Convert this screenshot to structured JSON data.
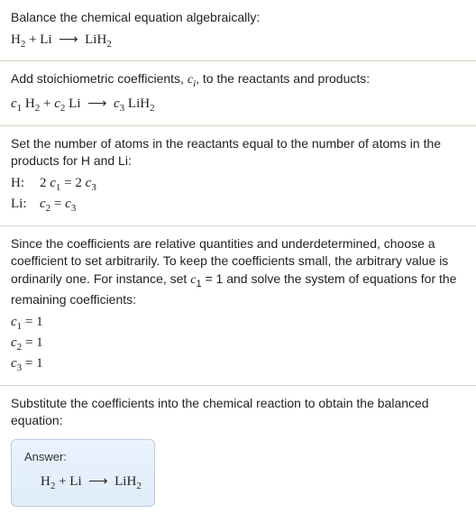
{
  "section1": {
    "text": "Balance the chemical equation algebraically:",
    "equation_html": "H<span class='sub'>2</span> + Li &nbsp;⟶&nbsp; LiH<span class='sub'>2</span>"
  },
  "section2": {
    "text_html": "Add stoichiometric coefficients, <span class='italic'>c<span class='sub'>i</span></span>, to the reactants and products:",
    "equation_html": "<span class='italic'>c</span><span class='sub'>1</span> H<span class='sub'>2</span> + <span class='italic'>c</span><span class='sub'>2</span> Li &nbsp;⟶&nbsp; <span class='italic'>c</span><span class='sub'>3</span> LiH<span class='sub'>2</span>"
  },
  "section3": {
    "text": "Set the number of atoms in the reactants equal to the number of atoms in the products for H and Li:",
    "rows": [
      {
        "label": "H:",
        "eq_html": "2 <span class='italic'>c</span><span class='sub'>1</span> = 2 <span class='italic'>c</span><span class='sub'>3</span>"
      },
      {
        "label": "Li:",
        "eq_html": "<span class='italic'>c</span><span class='sub'>2</span> = <span class='italic'>c</span><span class='sub'>3</span>"
      }
    ]
  },
  "section4": {
    "text_html": "Since the coefficients are relative quantities and underdetermined, choose a coefficient to set arbitrarily. To keep the coefficients small, the arbitrary value is ordinarily one. For instance, set <span class='italic'>c</span><span class='sub'>1</span> = 1 and solve the system of equations for the remaining coefficients:",
    "coeffs": [
      "<span class='italic'>c</span><span class='sub'>1</span> = 1",
      "<span class='italic'>c</span><span class='sub'>2</span> = 1",
      "<span class='italic'>c</span><span class='sub'>3</span> = 1"
    ]
  },
  "section5": {
    "text": "Substitute the coefficients into the chemical reaction to obtain the balanced equation:",
    "answer_label": "Answer:",
    "answer_eq_html": "H<span class='sub'>2</span> + Li &nbsp;⟶&nbsp; LiH<span class='sub'>2</span>"
  }
}
